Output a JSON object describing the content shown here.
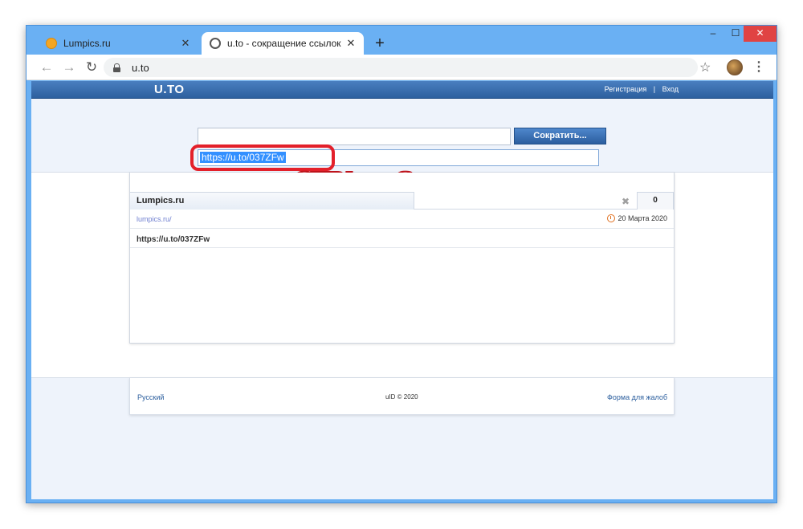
{
  "browser": {
    "tabs": [
      {
        "title": "Lumpics.ru",
        "icon": "lumpics-favicon-icon"
      },
      {
        "title": "u.to - сокращение ссылок",
        "icon": "globe-icon"
      }
    ],
    "new_tab": "+",
    "address": "u.to",
    "window_controls": {
      "minimize": "‒",
      "maximize": "☐",
      "close": "✕"
    }
  },
  "site": {
    "logo": "U.TO",
    "register": "Регистрация",
    "separator": "|",
    "login": "Вход"
  },
  "form": {
    "url_value": "",
    "shorten_button": "Сократить...",
    "result_value": "https://u.to/037ZFw"
  },
  "annotation": {
    "hotkey": "CTRL + C",
    "color": "#e3202a"
  },
  "list": {
    "item_title": "Lumpics.ru",
    "click_count": "0",
    "source_link": "lumpics.ru/",
    "date": "20 Марта 2020",
    "short_url": "https://u.to/037ZFw"
  },
  "footer": {
    "language": "Русский",
    "copyright": "uID © 2020",
    "complaint": "Форма для жалоб"
  }
}
